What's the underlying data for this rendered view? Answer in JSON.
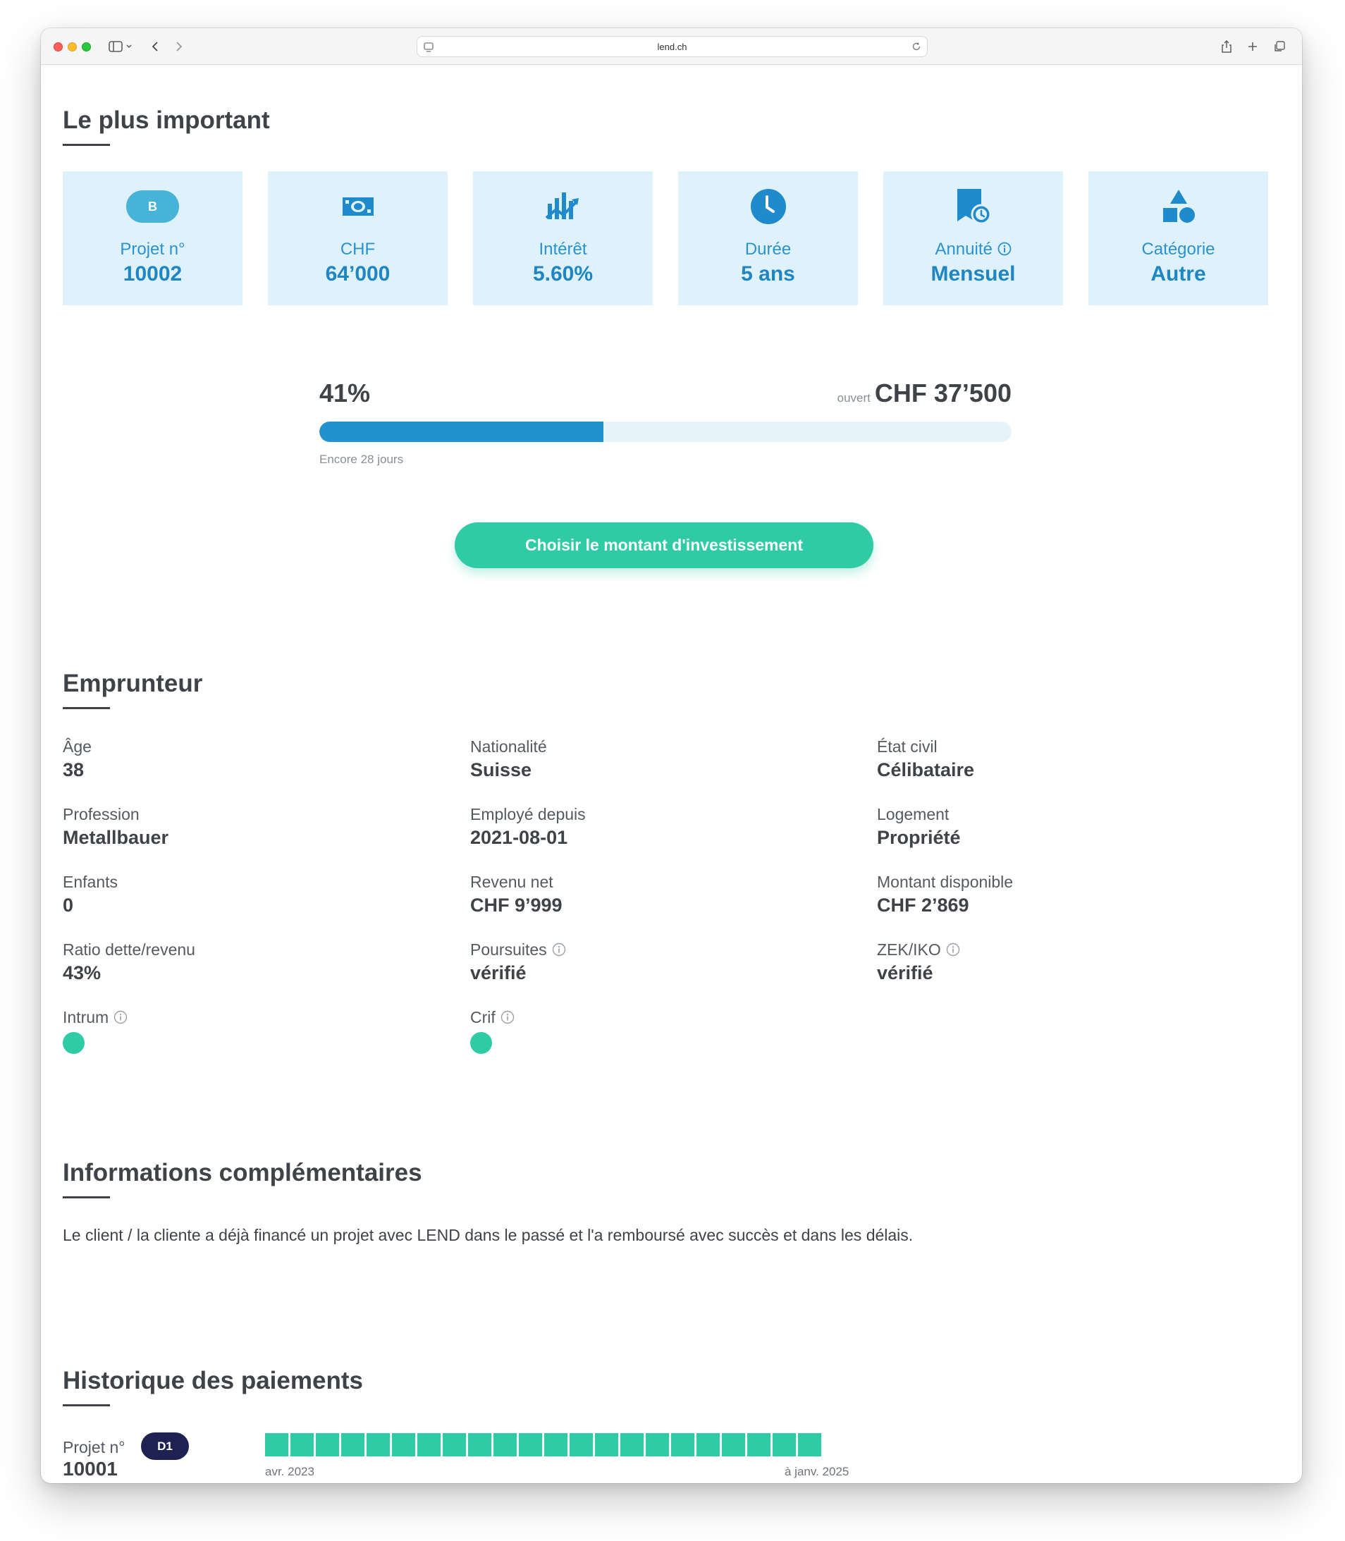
{
  "browser": {
    "url": "lend.ch"
  },
  "highlights": {
    "title": "Le plus important",
    "cards": [
      {
        "icon": "badge-b-icon",
        "badge": "B",
        "label": "Projet n°",
        "value": "10002"
      },
      {
        "icon": "banknote-icon",
        "label": "CHF",
        "value": "64’000"
      },
      {
        "icon": "growth-chart-icon",
        "label": "Intérêt",
        "value": "5.60%"
      },
      {
        "icon": "clock-icon",
        "label": "Durée",
        "value": "5 ans"
      },
      {
        "icon": "calendar-clock-icon",
        "label": "Annuité",
        "value": "Mensuel"
      },
      {
        "icon": "shapes-icon",
        "label": "Catégorie",
        "value": "Autre"
      }
    ]
  },
  "funding": {
    "percent_label": "41%",
    "percent": 41,
    "open_label": "ouvert",
    "open_value": "CHF 37’500",
    "remaining": "Encore 28 jours",
    "cta_label": "Choisir le montant d'investissement",
    "accent_color": "#2192cd",
    "cta_color": "#2ecba4"
  },
  "borrower": {
    "title": "Emprunteur",
    "fields": [
      {
        "label": "Âge",
        "value": "38"
      },
      {
        "label": "Nationalité",
        "value": "Suisse"
      },
      {
        "label": "État civil",
        "value": "Célibataire"
      },
      {
        "label": "Profession",
        "value": "Metallbauer"
      },
      {
        "label": "Employé depuis",
        "value": "2021-08-01"
      },
      {
        "label": "Logement",
        "value": "Propriété"
      },
      {
        "label": "Enfants",
        "value": "0"
      },
      {
        "label": "Revenu net",
        "value": "CHF 9’999"
      },
      {
        "label": "Montant disponible",
        "value": "CHF 2’869"
      },
      {
        "label": "Ratio dette/revenu",
        "value": "43%"
      },
      {
        "label": "Poursuites",
        "value": "vérifié"
      },
      {
        "label": "ZEK/IKO",
        "value": "vérifié"
      },
      {
        "label": "Intrum",
        "status": "ok"
      },
      {
        "label": "Crif",
        "status": "ok"
      }
    ]
  },
  "additional": {
    "title": "Informations complémentaires",
    "text": "Le client / la cliente a déjà financé un projet avec LEND dans le passé et l'a remboursé avec succès et dans les délais."
  },
  "history": {
    "title": "Historique des paiements",
    "project_label": "Projet n°",
    "badge": "D1",
    "project_value": "10001",
    "payments_count": 22,
    "payment_status": "paid",
    "start": "avr. 2023",
    "end": "à janv. 2025"
  }
}
